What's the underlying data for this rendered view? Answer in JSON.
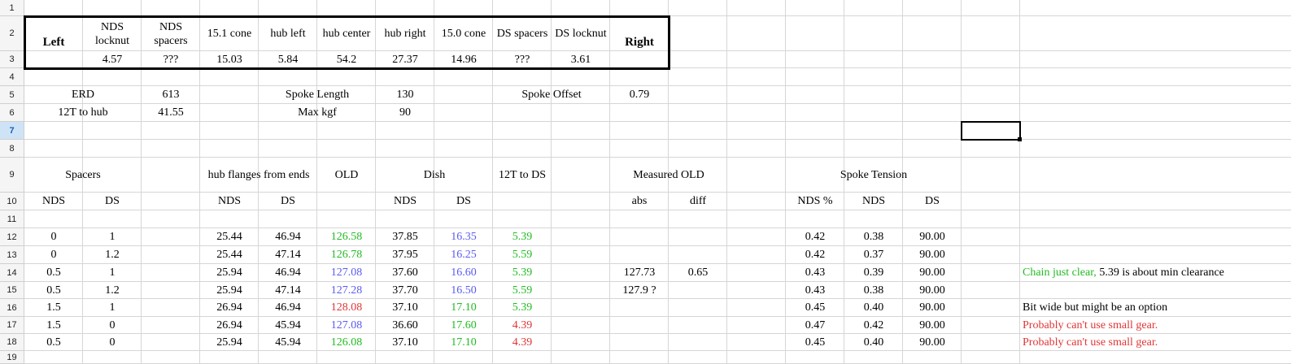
{
  "colors": {
    "green": "#22bb22",
    "blue": "#5b5bf0",
    "red": "#e03535",
    "black": "#000000"
  },
  "row_headers": [
    "1",
    "2",
    "3",
    "4",
    "5",
    "6",
    "7",
    "8",
    "9",
    "10",
    "11",
    "12",
    "13",
    "14",
    "15",
    "16",
    "17",
    "18",
    "19"
  ],
  "active_row": "7",
  "cells": [
    {
      "r": 2,
      "c": 0,
      "t": "Left",
      "bold": true,
      "rs": 2
    },
    {
      "r": 2,
      "c": 1,
      "t": "NDS locknut",
      "wrap": true
    },
    {
      "r": 2,
      "c": 2,
      "t": "NDS spacers",
      "wrap": true
    },
    {
      "r": 2,
      "c": 3,
      "t": "15.1 cone"
    },
    {
      "r": 2,
      "c": 4,
      "t": "hub left"
    },
    {
      "r": 2,
      "c": 5,
      "t": "hub center",
      "wrap": true
    },
    {
      "r": 2,
      "c": 6,
      "t": "hub right"
    },
    {
      "r": 2,
      "c": 7,
      "t": "15.0 cone"
    },
    {
      "r": 2,
      "c": 8,
      "t": "DS spacers",
      "wrap": true
    },
    {
      "r": 2,
      "c": 9,
      "t": "DS locknut",
      "wrap": true
    },
    {
      "r": 2,
      "c": 10,
      "t": "Right",
      "bold": true,
      "rs": 2
    },
    {
      "r": 3,
      "c": 1,
      "t": "4.57"
    },
    {
      "r": 3,
      "c": 2,
      "t": "???"
    },
    {
      "r": 3,
      "c": 3,
      "t": "15.03"
    },
    {
      "r": 3,
      "c": 4,
      "t": "5.84"
    },
    {
      "r": 3,
      "c": 5,
      "t": "54.2"
    },
    {
      "r": 3,
      "c": 6,
      "t": "27.37"
    },
    {
      "r": 3,
      "c": 7,
      "t": "14.96"
    },
    {
      "r": 3,
      "c": 8,
      "t": "???"
    },
    {
      "r": 3,
      "c": 9,
      "t": "3.61"
    },
    {
      "r": 5,
      "c": 0,
      "t": "ERD",
      "cs": 2
    },
    {
      "r": 5,
      "c": 2,
      "t": "613"
    },
    {
      "r": 5,
      "c": 4,
      "t": "Spoke Length",
      "cs": 2
    },
    {
      "r": 5,
      "c": 6,
      "t": "130"
    },
    {
      "r": 5,
      "c": 8,
      "t": "Spoke Offset",
      "cs": 2
    },
    {
      "r": 5,
      "c": 10,
      "t": "0.79"
    },
    {
      "r": 6,
      "c": 0,
      "t": "12T to hub",
      "cs": 2
    },
    {
      "r": 6,
      "c": 2,
      "t": "41.55"
    },
    {
      "r": 6,
      "c": 4,
      "t": "Max kgf",
      "cs": 2
    },
    {
      "r": 6,
      "c": 6,
      "t": "90"
    },
    {
      "r": 9,
      "c": 0,
      "t": "Spacers",
      "cs": 2
    },
    {
      "r": 9,
      "c": 3,
      "t": "hub flanges from ends",
      "cs": 2,
      "wrap": true
    },
    {
      "r": 9,
      "c": 5,
      "t": "OLD"
    },
    {
      "r": 9,
      "c": 6,
      "t": "Dish",
      "cs": 2
    },
    {
      "r": 9,
      "c": 8,
      "t": "12T to DS"
    },
    {
      "r": 9,
      "c": 10,
      "t": "Measured OLD",
      "cs": 2,
      "wrap": true
    },
    {
      "r": 9,
      "c": 13,
      "t": "Spoke Tension",
      "cs": 3
    },
    {
      "r": 10,
      "c": 0,
      "t": "NDS"
    },
    {
      "r": 10,
      "c": 1,
      "t": "DS"
    },
    {
      "r": 10,
      "c": 3,
      "t": "NDS"
    },
    {
      "r": 10,
      "c": 4,
      "t": "DS"
    },
    {
      "r": 10,
      "c": 6,
      "t": "NDS"
    },
    {
      "r": 10,
      "c": 7,
      "t": "DS"
    },
    {
      "r": 10,
      "c": 10,
      "t": "abs"
    },
    {
      "r": 10,
      "c": 11,
      "t": "diff"
    },
    {
      "r": 10,
      "c": 13,
      "t": "NDS %"
    },
    {
      "r": 10,
      "c": 14,
      "t": "NDS"
    },
    {
      "r": 10,
      "c": 15,
      "t": "DS"
    },
    {
      "r": 12,
      "c": 0,
      "t": "0"
    },
    {
      "r": 12,
      "c": 1,
      "t": "1"
    },
    {
      "r": 12,
      "c": 3,
      "t": "25.44"
    },
    {
      "r": 12,
      "c": 4,
      "t": "46.94"
    },
    {
      "r": 12,
      "c": 5,
      "t": "126.58",
      "col": "green"
    },
    {
      "r": 12,
      "c": 6,
      "t": "37.85"
    },
    {
      "r": 12,
      "c": 7,
      "t": "16.35",
      "col": "blue"
    },
    {
      "r": 12,
      "c": 8,
      "t": "5.39",
      "col": "green"
    },
    {
      "r": 12,
      "c": 13,
      "t": "0.42"
    },
    {
      "r": 12,
      "c": 14,
      "t": "0.38"
    },
    {
      "r": 12,
      "c": 15,
      "t": "90.00"
    },
    {
      "r": 13,
      "c": 0,
      "t": "0"
    },
    {
      "r": 13,
      "c": 1,
      "t": "1.2"
    },
    {
      "r": 13,
      "c": 3,
      "t": "25.44"
    },
    {
      "r": 13,
      "c": 4,
      "t": "47.14"
    },
    {
      "r": 13,
      "c": 5,
      "t": "126.78",
      "col": "green"
    },
    {
      "r": 13,
      "c": 6,
      "t": "37.95"
    },
    {
      "r": 13,
      "c": 7,
      "t": "16.25",
      "col": "blue"
    },
    {
      "r": 13,
      "c": 8,
      "t": "5.59",
      "col": "green"
    },
    {
      "r": 13,
      "c": 13,
      "t": "0.42"
    },
    {
      "r": 13,
      "c": 14,
      "t": "0.37"
    },
    {
      "r": 13,
      "c": 15,
      "t": "90.00"
    },
    {
      "r": 14,
      "c": 0,
      "t": "0.5"
    },
    {
      "r": 14,
      "c": 1,
      "t": "1"
    },
    {
      "r": 14,
      "c": 3,
      "t": "25.94"
    },
    {
      "r": 14,
      "c": 4,
      "t": "46.94"
    },
    {
      "r": 14,
      "c": 5,
      "t": "127.08",
      "col": "blue"
    },
    {
      "r": 14,
      "c": 6,
      "t": "37.60"
    },
    {
      "r": 14,
      "c": 7,
      "t": "16.60",
      "col": "blue"
    },
    {
      "r": 14,
      "c": 8,
      "t": "5.39",
      "col": "green"
    },
    {
      "r": 14,
      "c": 10,
      "t": "127.73"
    },
    {
      "r": 14,
      "c": 11,
      "t": "0.65"
    },
    {
      "r": 14,
      "c": 13,
      "t": "0.43"
    },
    {
      "r": 14,
      "c": 14,
      "t": "0.39"
    },
    {
      "r": 14,
      "c": 15,
      "t": "90.00"
    },
    {
      "r": 14,
      "c": 17,
      "t": "Chain just clear,",
      "col": "green",
      "note": true,
      "tail": " 5.39 is about min clearance"
    },
    {
      "r": 15,
      "c": 0,
      "t": "0.5"
    },
    {
      "r": 15,
      "c": 1,
      "t": "1.2"
    },
    {
      "r": 15,
      "c": 3,
      "t": "25.94"
    },
    {
      "r": 15,
      "c": 4,
      "t": "47.14"
    },
    {
      "r": 15,
      "c": 5,
      "t": "127.28",
      "col": "blue"
    },
    {
      "r": 15,
      "c": 6,
      "t": "37.70"
    },
    {
      "r": 15,
      "c": 7,
      "t": "16.50",
      "col": "blue"
    },
    {
      "r": 15,
      "c": 8,
      "t": "5.59",
      "col": "green"
    },
    {
      "r": 15,
      "c": 10,
      "t": "127.9 ?"
    },
    {
      "r": 15,
      "c": 13,
      "t": "0.43"
    },
    {
      "r": 15,
      "c": 14,
      "t": "0.38"
    },
    {
      "r": 15,
      "c": 15,
      "t": "90.00"
    },
    {
      "r": 16,
      "c": 0,
      "t": "1.5"
    },
    {
      "r": 16,
      "c": 1,
      "t": "1"
    },
    {
      "r": 16,
      "c": 3,
      "t": "26.94"
    },
    {
      "r": 16,
      "c": 4,
      "t": "46.94"
    },
    {
      "r": 16,
      "c": 5,
      "t": "128.08",
      "col": "red"
    },
    {
      "r": 16,
      "c": 6,
      "t": "37.10"
    },
    {
      "r": 16,
      "c": 7,
      "t": "17.10",
      "col": "green"
    },
    {
      "r": 16,
      "c": 8,
      "t": "5.39",
      "col": "green"
    },
    {
      "r": 16,
      "c": 13,
      "t": "0.45"
    },
    {
      "r": 16,
      "c": 14,
      "t": "0.40"
    },
    {
      "r": 16,
      "c": 15,
      "t": "90.00"
    },
    {
      "r": 16,
      "c": 17,
      "t": "Bit wide but might be an option",
      "note": true
    },
    {
      "r": 17,
      "c": 0,
      "t": "1.5"
    },
    {
      "r": 17,
      "c": 1,
      "t": "0"
    },
    {
      "r": 17,
      "c": 3,
      "t": "26.94"
    },
    {
      "r": 17,
      "c": 4,
      "t": "45.94"
    },
    {
      "r": 17,
      "c": 5,
      "t": "127.08",
      "col": "blue"
    },
    {
      "r": 17,
      "c": 6,
      "t": "36.60"
    },
    {
      "r": 17,
      "c": 7,
      "t": "17.60",
      "col": "green"
    },
    {
      "r": 17,
      "c": 8,
      "t": "4.39",
      "col": "red"
    },
    {
      "r": 17,
      "c": 13,
      "t": "0.47"
    },
    {
      "r": 17,
      "c": 14,
      "t": "0.42"
    },
    {
      "r": 17,
      "c": 15,
      "t": "90.00"
    },
    {
      "r": 17,
      "c": 17,
      "t": "Probably can't use small gear.",
      "col": "red",
      "note": true
    },
    {
      "r": 18,
      "c": 0,
      "t": "0.5"
    },
    {
      "r": 18,
      "c": 1,
      "t": "0"
    },
    {
      "r": 18,
      "c": 3,
      "t": "25.94"
    },
    {
      "r": 18,
      "c": 4,
      "t": "45.94"
    },
    {
      "r": 18,
      "c": 5,
      "t": "126.08",
      "col": "green"
    },
    {
      "r": 18,
      "c": 6,
      "t": "37.10"
    },
    {
      "r": 18,
      "c": 7,
      "t": "17.10",
      "col": "green"
    },
    {
      "r": 18,
      "c": 8,
      "t": "4.39",
      "col": "red"
    },
    {
      "r": 18,
      "c": 13,
      "t": "0.45"
    },
    {
      "r": 18,
      "c": 14,
      "t": "0.40"
    },
    {
      "r": 18,
      "c": 15,
      "t": "90.00"
    },
    {
      "r": 18,
      "c": 17,
      "t": "Probably can't use small gear.",
      "col": "red",
      "note": true
    }
  ]
}
